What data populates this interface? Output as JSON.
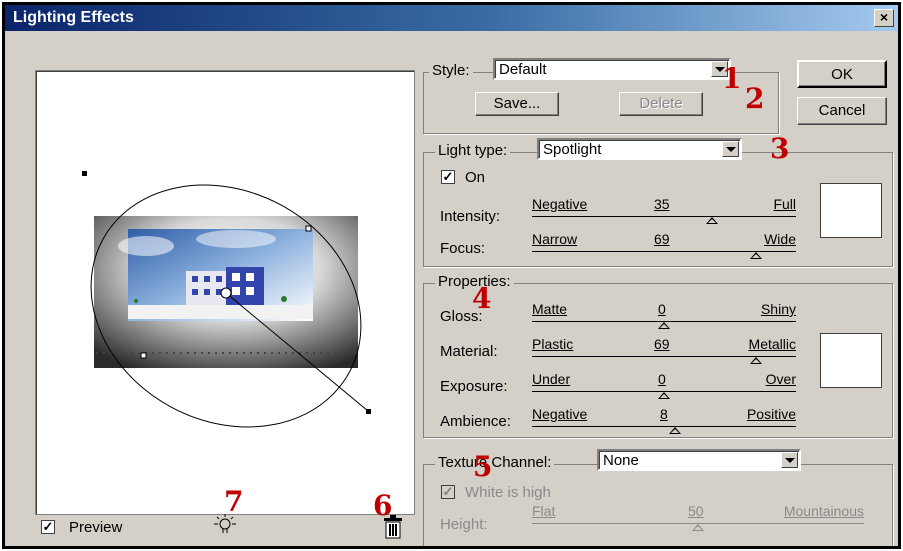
{
  "window": {
    "title": "Lighting Effects",
    "close_glyph": "×"
  },
  "style": {
    "label": "Style:",
    "value": "Default",
    "save_label": "Save...",
    "delete_label": "Delete"
  },
  "buttons": {
    "ok": "OK",
    "cancel": "Cancel"
  },
  "light": {
    "type_label": "Light type:",
    "type_value": "Spotlight",
    "on_label": "On",
    "on_checked": true,
    "intensity": {
      "label": "Intensity:",
      "left": "Negative",
      "value": "35",
      "right": "Full",
      "level": 0.68
    },
    "focus": {
      "label": "Focus:",
      "left": "Narrow",
      "value": "69",
      "right": "Wide",
      "level": 0.85
    }
  },
  "properties": {
    "header": "Properties:",
    "gloss": {
      "label": "Gloss:",
      "left": "Matte",
      "value": "0",
      "right": "Shiny",
      "level": 0.5
    },
    "material": {
      "label": "Material:",
      "left": "Plastic",
      "value": "69",
      "right": "Metallic",
      "level": 0.85
    },
    "exposure": {
      "label": "Exposure:",
      "left": "Under",
      "value": "0",
      "right": "Over",
      "level": 0.5
    },
    "ambience": {
      "label": "Ambience:",
      "left": "Negative",
      "value": "8",
      "right": "Positive",
      "level": 0.54
    }
  },
  "texture": {
    "channel_label": "Texture Channel:",
    "channel_value": "None",
    "white_high_label": "White is high",
    "height": {
      "label": "Height:",
      "left": "Flat",
      "value": "50",
      "right": "Mountainous",
      "level": 0.5
    }
  },
  "preview": {
    "label": "Preview",
    "checked": true
  },
  "icons": {
    "bulb": "light-bulb-icon",
    "trash": "trash-icon"
  },
  "annotations": [
    "1",
    "2",
    "3",
    "4",
    "5",
    "6",
    "7"
  ],
  "colors": {
    "titlebar_start": "#0a246a",
    "titlebar_end": "#a6caf0",
    "annotation": "#c00000",
    "dialog_bg": "#d4d0c8"
  }
}
